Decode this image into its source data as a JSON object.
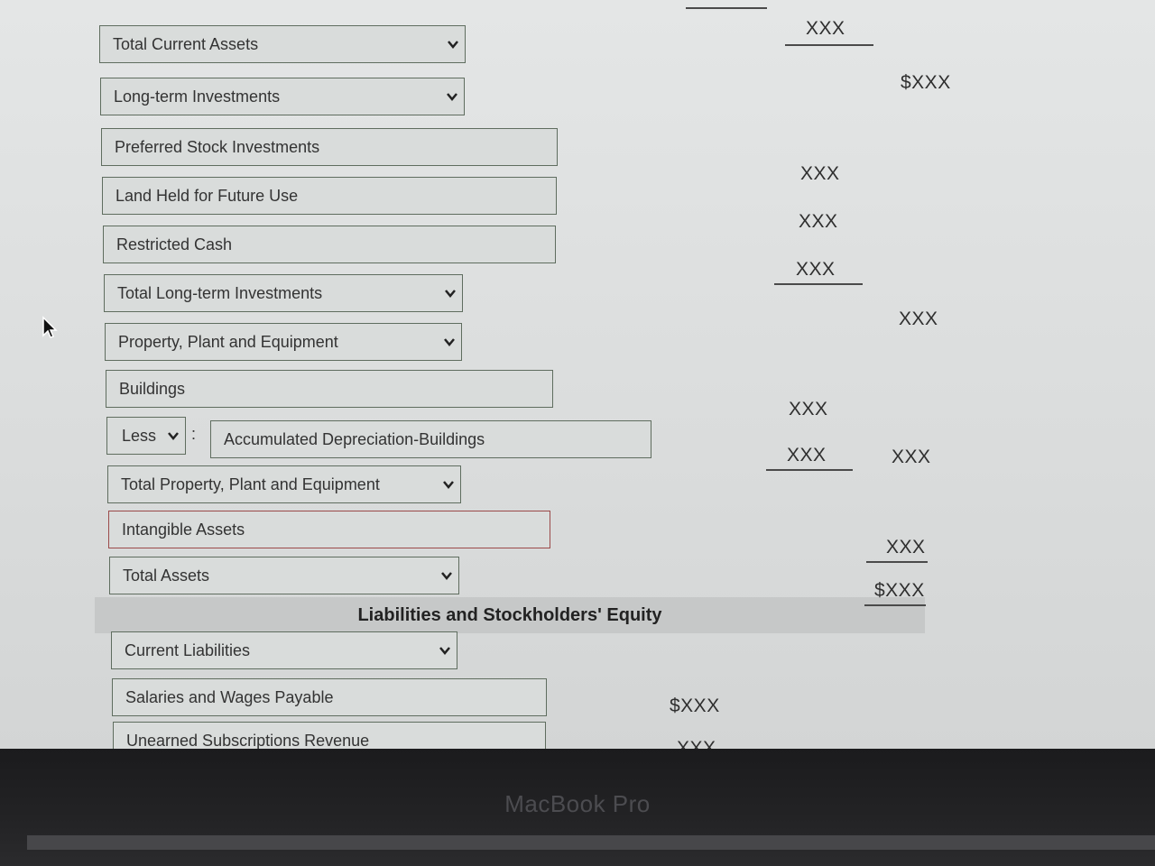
{
  "fields": {
    "total_current_assets": "Total Current Assets",
    "long_term_investments": "Long-term Investments",
    "preferred_stock_investments": "Preferred Stock Investments",
    "land_held_future_use": "Land Held for Future Use",
    "restricted_cash": "Restricted Cash",
    "total_long_term_investments": "Total Long-term Investments",
    "ppe": "Property, Plant and Equipment",
    "buildings": "Buildings",
    "less_select": "Less",
    "colon": ":",
    "accum_dep_buildings": "Accumulated Depreciation-Buildings",
    "total_ppe": "Total Property, Plant and Equipment",
    "intangible_assets": "Intangible Assets",
    "total_assets": "Total Assets",
    "current_liabilities": "Current Liabilities",
    "salaries_wages_payable": "Salaries and Wages Payable",
    "unearned_subscriptions_revenue": "Unearned Subscriptions Revenue"
  },
  "section_header": "Liabilities and Stockholders' Equity",
  "amounts": {
    "a1": "XXX",
    "a2": "$XXX",
    "a3": "XXX",
    "a4": "XXX",
    "a5": "XXX",
    "a6": "XXX",
    "a7": "XXX",
    "a8": "XXX",
    "a9": "XXX",
    "a10": "XXX",
    "a11": "$XXX",
    "a12": "$XXX",
    "a13": "XXX"
  },
  "device_label": "MacBook Pro",
  "colors": {
    "field_border": "#5f6d5f",
    "error_border": "#9b4a4a",
    "background": "#dadcdc"
  },
  "icons": [
    "chevron-down-icon",
    "mouse-cursor-icon"
  ]
}
